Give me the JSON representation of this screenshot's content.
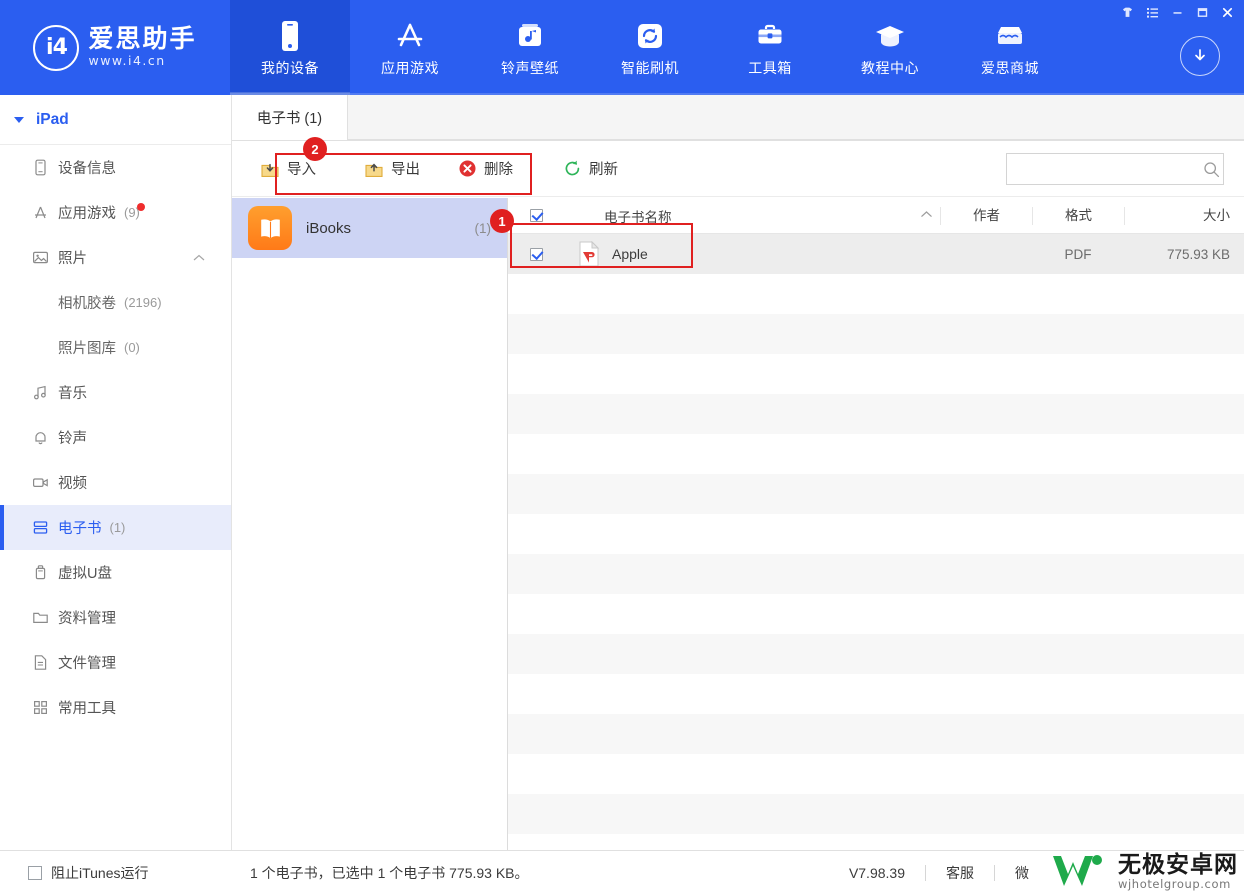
{
  "brand": {
    "mark": "i4",
    "title": "爱思助手",
    "url": "www.i4.cn"
  },
  "window_controls": [
    {
      "name": "skin-icon",
      "glyph": "♣"
    },
    {
      "name": "menu-icon",
      "glyph": "☰"
    },
    {
      "name": "minimize-icon",
      "glyph": "–"
    },
    {
      "name": "maximize-icon",
      "glyph": "❐"
    },
    {
      "name": "close-icon",
      "glyph": "✕"
    }
  ],
  "nav": [
    {
      "label": "我的设备",
      "icon": "device-icon",
      "active": true
    },
    {
      "label": "应用游戏",
      "icon": "appstore-icon",
      "active": false
    },
    {
      "label": "铃声壁纸",
      "icon": "ringtone-icon",
      "active": false
    },
    {
      "label": "智能刷机",
      "icon": "flash-icon",
      "active": false
    },
    {
      "label": "工具箱",
      "icon": "toolbox-icon",
      "active": false
    },
    {
      "label": "教程中心",
      "icon": "graduation-icon",
      "active": false
    },
    {
      "label": "爱思商城",
      "icon": "shop-icon",
      "active": false
    }
  ],
  "download_button": "download-icon",
  "sidebar": {
    "device": "iPad",
    "items": [
      {
        "label": "设备信息",
        "icon": "device-info-icon",
        "count": "",
        "dot": false,
        "selected": false,
        "sub": false
      },
      {
        "label": "应用游戏",
        "icon": "appstore-icon",
        "count": "(9)",
        "dot": true,
        "selected": false,
        "sub": false
      },
      {
        "label": "照片",
        "icon": "photo-icon",
        "count": "",
        "dot": false,
        "selected": false,
        "sub": false,
        "collapse": "⌃"
      },
      {
        "label": "相机胶卷",
        "icon": "",
        "count": "(2196)",
        "dot": false,
        "selected": false,
        "sub": true
      },
      {
        "label": "照片图库",
        "icon": "",
        "count": "(0)",
        "dot": false,
        "selected": false,
        "sub": true
      },
      {
        "label": "音乐",
        "icon": "music-icon",
        "count": "",
        "dot": false,
        "selected": false,
        "sub": false
      },
      {
        "label": "铃声",
        "icon": "bell-icon",
        "count": "",
        "dot": false,
        "selected": false,
        "sub": false
      },
      {
        "label": "视频",
        "icon": "video-icon",
        "count": "",
        "dot": false,
        "selected": false,
        "sub": false
      },
      {
        "label": "电子书",
        "icon": "ebook-icon",
        "count": "(1)",
        "dot": false,
        "selected": true,
        "sub": false
      },
      {
        "label": "虚拟U盘",
        "icon": "usb-icon",
        "count": "",
        "dot": false,
        "selected": false,
        "sub": false
      },
      {
        "label": "资料管理",
        "icon": "folder-icon",
        "count": "",
        "dot": false,
        "selected": false,
        "sub": false
      },
      {
        "label": "文件管理",
        "icon": "file-icon",
        "count": "",
        "dot": false,
        "selected": false,
        "sub": false
      },
      {
        "label": "常用工具",
        "icon": "grid-icon",
        "count": "",
        "dot": false,
        "selected": false,
        "sub": false
      }
    ]
  },
  "tabs": [
    {
      "label": "电子书 (1)",
      "active": true
    }
  ],
  "toolbar": {
    "import_label": "导入",
    "export_label": "导出",
    "delete_label": "删除",
    "refresh_label": "刷新"
  },
  "search": {
    "value": "",
    "placeholder": ""
  },
  "app_list": [
    {
      "name": "iBooks",
      "count": "(1)",
      "selected": true,
      "icon": "ibooks-icon"
    }
  ],
  "file_table": {
    "header_checkbox_checked": true,
    "columns": {
      "name": "电子书名称",
      "sort_glyph": "⌃",
      "author": "作者",
      "format": "格式",
      "size": "大小"
    },
    "rows": [
      {
        "checked": true,
        "name": "Apple",
        "author": "",
        "format": "PDF",
        "size": "775.93 KB",
        "icon": "pdf-icon",
        "selected": true
      }
    ],
    "empty_row_count": 14
  },
  "annotations": [
    {
      "badge": "1",
      "target": "selected-file-row"
    },
    {
      "badge": "2",
      "target": "export-delete-group"
    }
  ],
  "status": {
    "block_itunes_label": "阻止iTunes运行",
    "block_itunes_checked": false,
    "summary": "1 个电子书，已选中 1 个电子书 775.93 KB。",
    "version": "V7.98.39",
    "support_label": "客服",
    "weibo_label": "微"
  },
  "watermark": {
    "title": "无极安卓网",
    "url": "wjhotelgroup.com"
  },
  "colors": {
    "brand_blue": "#2b5ef0",
    "nav_active": "#1f4fd8",
    "sidebar_selected": "#e8ecfb",
    "app_selected": "#cdd4f4",
    "annotation_red": "#e02020",
    "ibooks_orange": "#ff7a18"
  }
}
